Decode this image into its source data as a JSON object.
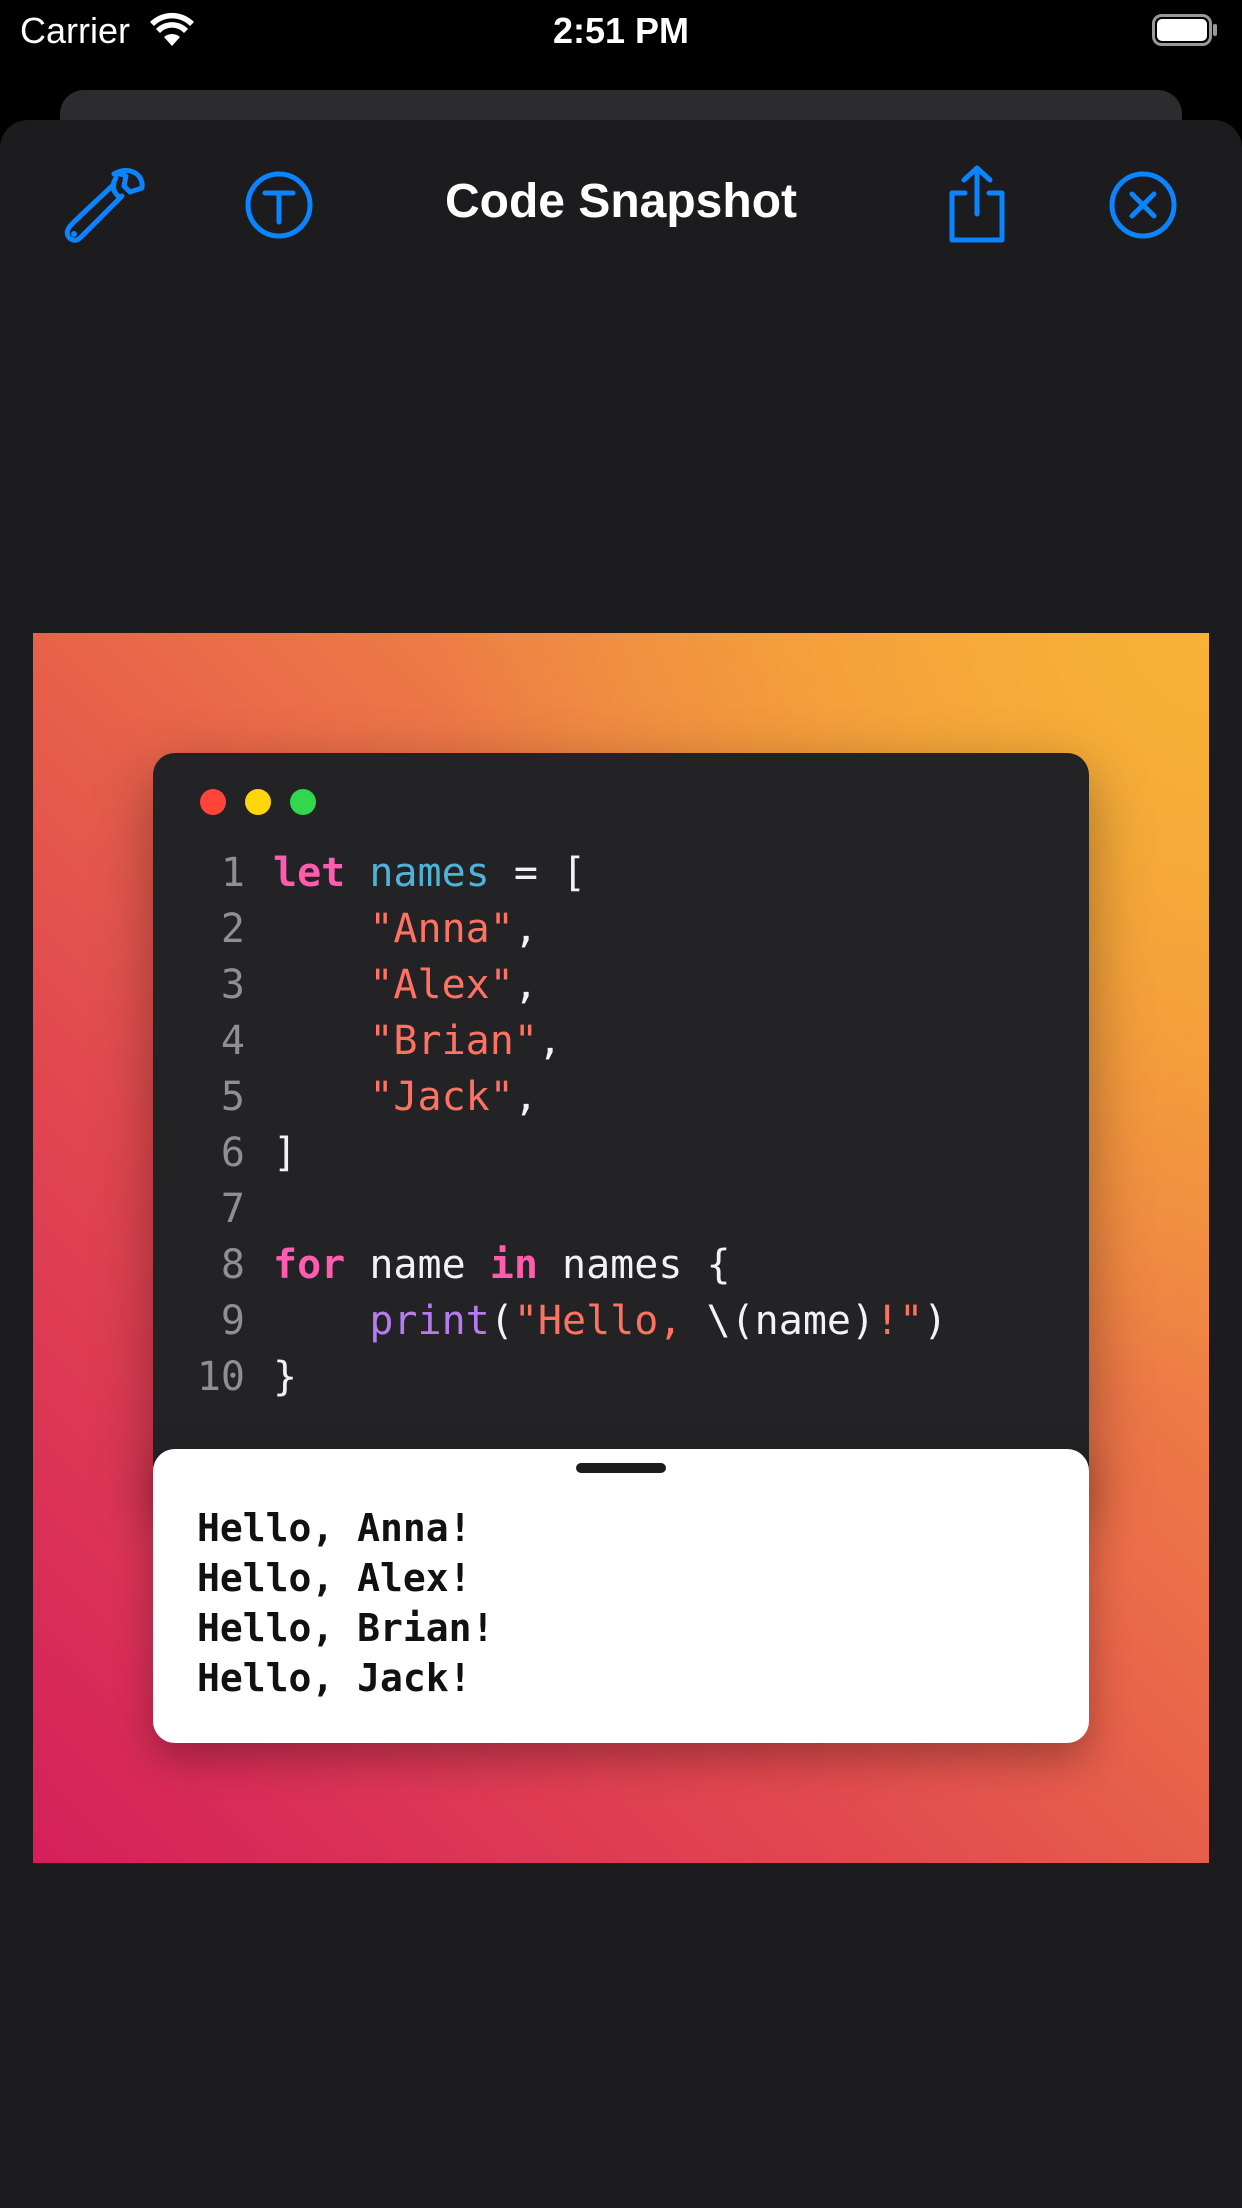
{
  "status_bar": {
    "carrier": "Carrier",
    "time": "2:51 PM"
  },
  "nav": {
    "title": "Code Snapshot",
    "icons": [
      "wrench-icon",
      "text-t-icon",
      "share-icon",
      "close-circle-icon"
    ],
    "accent_color": "#0a84ff"
  },
  "code": {
    "lines": [
      {
        "n": "1",
        "parts": [
          {
            "t": "let",
            "c": "kw"
          },
          {
            "t": " "
          },
          {
            "t": "names",
            "c": "var"
          },
          {
            "t": " = ["
          }
        ]
      },
      {
        "n": "2",
        "parts": [
          {
            "t": "    "
          },
          {
            "t": "\"Anna\"",
            "c": "str"
          },
          {
            "t": ","
          }
        ]
      },
      {
        "n": "3",
        "parts": [
          {
            "t": "    "
          },
          {
            "t": "\"Alex\"",
            "c": "str"
          },
          {
            "t": ","
          }
        ]
      },
      {
        "n": "4",
        "parts": [
          {
            "t": "    "
          },
          {
            "t": "\"Brian\"",
            "c": "str"
          },
          {
            "t": ","
          }
        ]
      },
      {
        "n": "5",
        "parts": [
          {
            "t": "    "
          },
          {
            "t": "\"Jack\"",
            "c": "str"
          },
          {
            "t": ","
          }
        ]
      },
      {
        "n": "6",
        "parts": [
          {
            "t": "]"
          }
        ]
      },
      {
        "n": "7",
        "parts": []
      },
      {
        "n": "8",
        "parts": [
          {
            "t": "for",
            "c": "kw"
          },
          {
            "t": " name "
          },
          {
            "t": "in",
            "c": "kw"
          },
          {
            "t": " names {"
          }
        ]
      },
      {
        "n": "9",
        "parts": [
          {
            "t": "    "
          },
          {
            "t": "print",
            "c": "fn"
          },
          {
            "t": "("
          },
          {
            "t": "\"Hello, ",
            "c": "str"
          },
          {
            "t": "\\(name)"
          },
          {
            "t": "!\"",
            "c": "str"
          },
          {
            "t": ")"
          }
        ]
      },
      {
        "n": "10",
        "parts": [
          {
            "t": "}"
          }
        ]
      }
    ]
  },
  "output": {
    "lines": [
      "Hello, Anna!",
      "Hello, Alex!",
      "Hello, Brian!",
      "Hello, Jack!"
    ]
  }
}
